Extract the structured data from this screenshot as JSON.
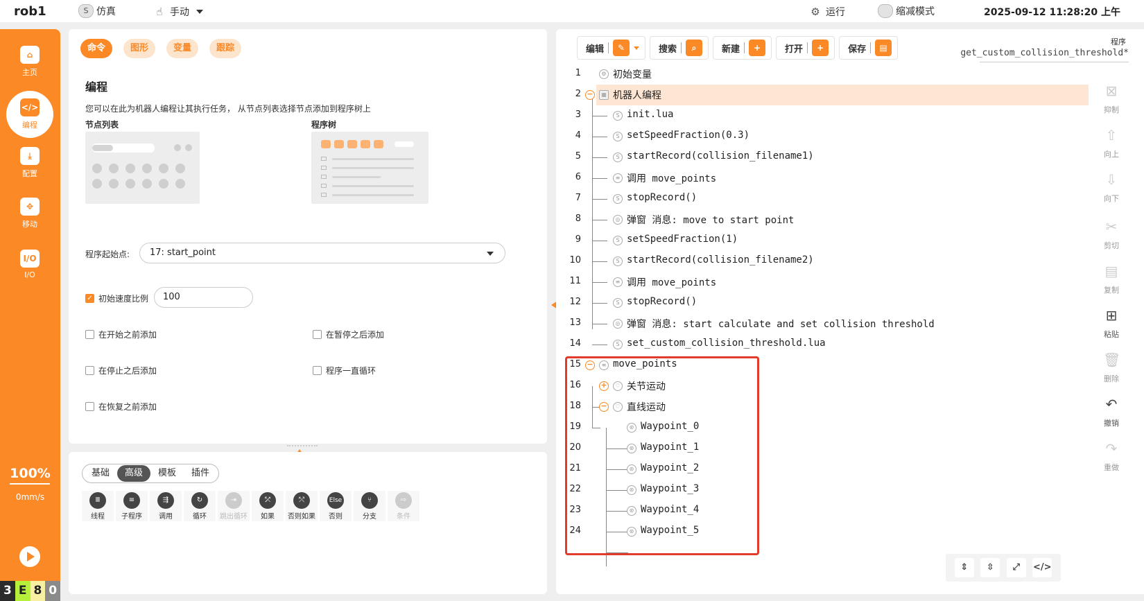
{
  "topbar": {
    "robot": "rob1",
    "mode": "仿真",
    "control": "手动",
    "run": "运行",
    "reduced": "缩减模式",
    "datetime": "2025-09-12 11:28:20 上午"
  },
  "sidebar": {
    "items": [
      {
        "label": "主页",
        "icon": "home-icon"
      },
      {
        "label": "编程",
        "icon": "code-icon"
      },
      {
        "label": "配置",
        "icon": "download-icon"
      },
      {
        "label": "移动",
        "icon": "move-icon"
      },
      {
        "label": "I/O",
        "icon": "io-icon"
      }
    ],
    "speed": "100%",
    "velocity": "0mm/s",
    "status": [
      "3",
      "E",
      "8",
      "0"
    ],
    "status_colors": [
      "#2b2b2b",
      "#b6f03a",
      "#f6f0a0",
      "#8a8a8a"
    ]
  },
  "left": {
    "tabs": [
      "命令",
      "图形",
      "变量",
      "跟踪"
    ],
    "title": "编程",
    "desc": "您可以在此为机器人编程让其执行任务， 从节点列表选择节点添加到程序树上",
    "node_list_label": "节点列表",
    "tree_label": "程序树",
    "start_label": "程序起始点:",
    "start_value": "17: start_point",
    "init_speed_label": "初始速度比例",
    "init_speed_value": "100",
    "options": [
      "在开始之前添加",
      "在暂停之后添加",
      "在停止之后添加",
      "程序一直循环",
      "在恢复之前添加"
    ]
  },
  "bottom": {
    "tabs": [
      "基础",
      "高级",
      "模板",
      "插件"
    ],
    "tools": [
      {
        "label": "线程",
        "icon": "thread-icon",
        "glyph": "Ⅲ"
      },
      {
        "label": "子程序",
        "icon": "subprogram-icon",
        "glyph": "≡"
      },
      {
        "label": "调用",
        "icon": "call-icon",
        "glyph": "⇶"
      },
      {
        "label": "循环",
        "icon": "loop-icon",
        "glyph": "↻"
      },
      {
        "label": "跳出循环",
        "icon": "break-icon",
        "glyph": "⇥"
      },
      {
        "label": "如果",
        "icon": "if-icon",
        "glyph": "⤱"
      },
      {
        "label": "否则如果",
        "icon": "elseif-icon",
        "glyph": "⤲"
      },
      {
        "label": "否则",
        "icon": "else-icon",
        "glyph": "Else"
      },
      {
        "label": "分支",
        "icon": "switch-icon",
        "glyph": "⑂"
      },
      {
        "label": "条件",
        "icon": "condition-icon",
        "glyph": "⇨"
      }
    ]
  },
  "right": {
    "buttons": [
      "编辑",
      "搜索",
      "新建",
      "打开",
      "保存"
    ],
    "program_label": "程序",
    "program_name": "get_custom_collision_threshold*",
    "rows": [
      {
        "num": "1",
        "text": "初始变量"
      },
      {
        "num": "2",
        "text": "机器人编程"
      },
      {
        "num": "3",
        "text": "init.lua"
      },
      {
        "num": "4",
        "text": "setSpeedFraction(0.3)"
      },
      {
        "num": "5",
        "text": "startRecord(collision_filename1)"
      },
      {
        "num": "6",
        "text": "调用 move_points"
      },
      {
        "num": "7",
        "text": "stopRecord()"
      },
      {
        "num": "8",
        "text": "弹窗 消息: move to start point"
      },
      {
        "num": "9",
        "text": "setSpeedFraction(1)"
      },
      {
        "num": "10",
        "text": "startRecord(collision_filename2)"
      },
      {
        "num": "11",
        "text": "调用 move_points"
      },
      {
        "num": "12",
        "text": "stopRecord()"
      },
      {
        "num": "13",
        "text": "弹窗 消息: start calculate and set collision threshold"
      },
      {
        "num": "14",
        "text": "set_custom_collision_threshold.lua"
      },
      {
        "num": "15",
        "text": "move_points"
      },
      {
        "num": "16",
        "text": "关节运动"
      },
      {
        "num": "18",
        "text": "直线运动"
      },
      {
        "num": "19",
        "text": "Waypoint_0"
      },
      {
        "num": "20",
        "text": "Waypoint_1"
      },
      {
        "num": "21",
        "text": "Waypoint_2"
      },
      {
        "num": "22",
        "text": "Waypoint_3"
      },
      {
        "num": "23",
        "text": "Waypoint_4"
      },
      {
        "num": "24",
        "text": "Waypoint_5"
      }
    ],
    "actions": [
      "抑制",
      "向上",
      "向下",
      "剪切",
      "复制",
      "粘贴",
      "删除",
      "撤销",
      "重做"
    ]
  }
}
